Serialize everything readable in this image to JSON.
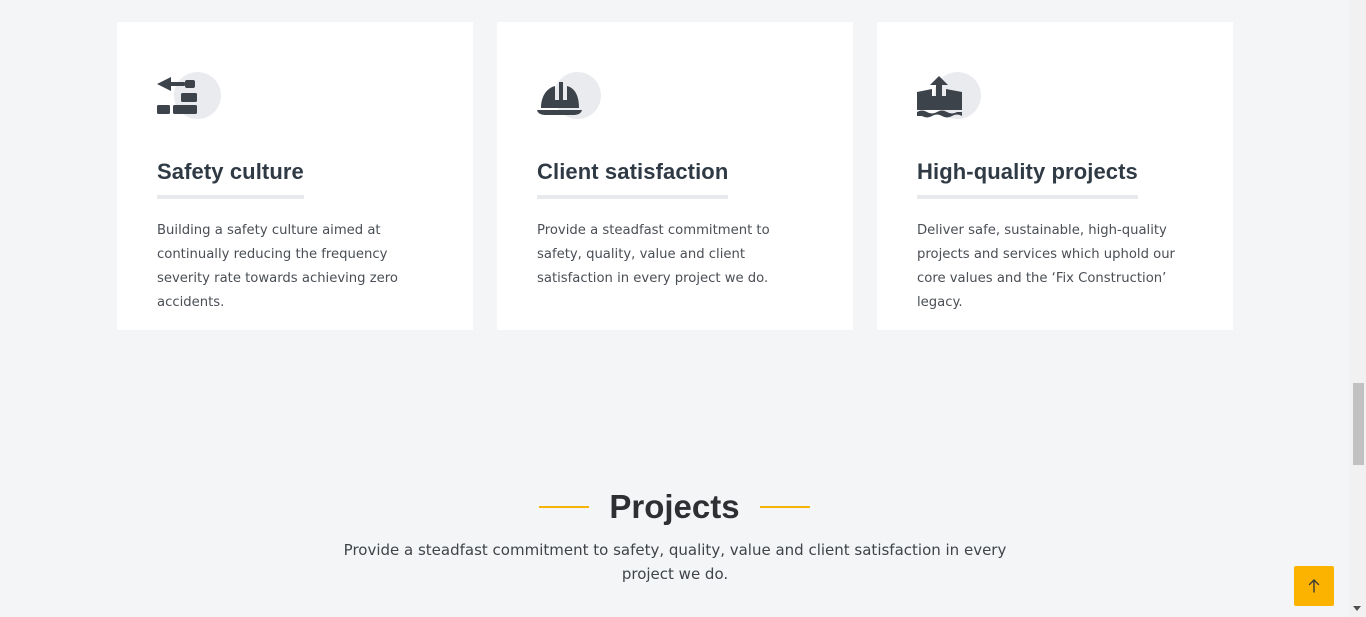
{
  "features": [
    {
      "icon": "trowel-bricks-icon",
      "title": "Safety culture",
      "description": "Building a safety culture aimed at continually reducing the frequency severity rate towards achieving zero accidents."
    },
    {
      "icon": "helmet-safety-icon",
      "title": "Client satisfaction",
      "description": "Provide a steadfast commitment to safety, quality, value and client satisfaction in every project we do."
    },
    {
      "icon": "house-flood-icon",
      "title": "High-quality projects",
      "description": "Deliver safe, sustainable, high-quality projects and services which uphold our core values and the ‘Fix Construction’ legacy."
    }
  ],
  "projects_section": {
    "title": "Projects",
    "subtitle": "Provide a steadfast commitment to safety, quality, value and client satisfaction in every project we do."
  },
  "back_to_top": {
    "icon": "arrow-up-icon"
  },
  "colors": {
    "accent": "#fbb300",
    "accent_line": "#f6b404",
    "heading": "#2f3a45",
    "icon": "#3c434b",
    "background": "#f4f5f7",
    "card": "#ffffff"
  }
}
